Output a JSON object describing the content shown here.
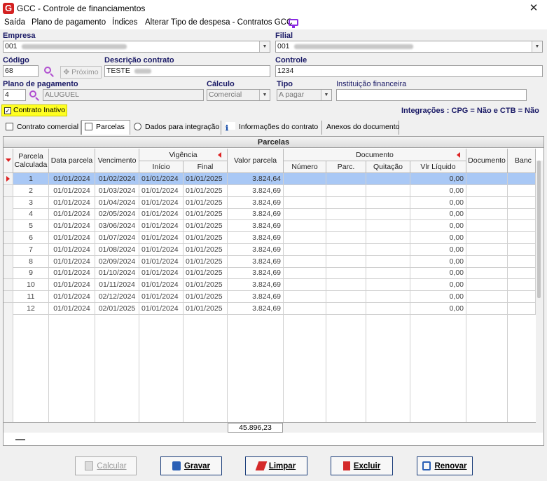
{
  "window": {
    "title": "GCC - Controle de financiamentos",
    "app_icon": "G"
  },
  "menu": [
    "Saída",
    "Plano de pagamento",
    "Índices",
    "Alterar Tipo de despesa - Contratos GCC"
  ],
  "form": {
    "empresa_label": "Empresa",
    "empresa_value": "001",
    "filial_label": "Filial",
    "filial_value": "001",
    "codigo_label": "Código",
    "codigo_value": "68",
    "proximo_label": "Próximo",
    "descricao_label": "Descrição contrato",
    "descricao_value": "TESTE",
    "controle_label": "Controle",
    "controle_value": "1234",
    "plano_label": "Plano de pagamento",
    "plano_code": "4",
    "plano_name": "ALUGUEL",
    "calculo_label": "Cálculo",
    "calculo_value": "Comercial",
    "tipo_label": "Tipo",
    "tipo_value": "A pagar",
    "instituicao_label": "Instituição financeira",
    "instituicao_value": "",
    "inativo_label": "Contrato Inativo",
    "inativo_checked": "✓",
    "integracoes": "Integrações : CPG = Não e CTB = Não"
  },
  "tabs": [
    "Contrato comercial",
    "Parcelas",
    "Dados para integração",
    "Informações do contrato",
    "Anexos do documento"
  ],
  "grid": {
    "title": "Parcelas",
    "headers": {
      "parcela": "Parcela Calculada",
      "data": "Data parcela",
      "vencimento": "Vencimento",
      "vigencia": "Vigência",
      "inicio": "Início",
      "final": "Final",
      "valor": "Valor parcela",
      "documento": "Documento",
      "numero": "Número",
      "parc": "Parc.",
      "quitacao": "Quitação",
      "vlr": "Vlr Líquido",
      "documento2": "Documento",
      "banco": "Banc"
    },
    "rows": [
      {
        "n": "1",
        "data": "01/01/2024",
        "venc": "01/02/2024",
        "ini": "01/01/2024",
        "fim": "01/01/2025",
        "valor": "3.824,64",
        "vlr": "0,00"
      },
      {
        "n": "2",
        "data": "01/01/2024",
        "venc": "01/03/2024",
        "ini": "01/01/2024",
        "fim": "01/01/2025",
        "valor": "3.824,69",
        "vlr": "0,00"
      },
      {
        "n": "3",
        "data": "01/01/2024",
        "venc": "01/04/2024",
        "ini": "01/01/2024",
        "fim": "01/01/2025",
        "valor": "3.824,69",
        "vlr": "0,00"
      },
      {
        "n": "4",
        "data": "01/01/2024",
        "venc": "02/05/2024",
        "ini": "01/01/2024",
        "fim": "01/01/2025",
        "valor": "3.824,69",
        "vlr": "0,00"
      },
      {
        "n": "5",
        "data": "01/01/2024",
        "venc": "03/06/2024",
        "ini": "01/01/2024",
        "fim": "01/01/2025",
        "valor": "3.824,69",
        "vlr": "0,00"
      },
      {
        "n": "6",
        "data": "01/01/2024",
        "venc": "01/07/2024",
        "ini": "01/01/2024",
        "fim": "01/01/2025",
        "valor": "3.824,69",
        "vlr": "0,00"
      },
      {
        "n": "7",
        "data": "01/01/2024",
        "venc": "01/08/2024",
        "ini": "01/01/2024",
        "fim": "01/01/2025",
        "valor": "3.824,69",
        "vlr": "0,00"
      },
      {
        "n": "8",
        "data": "01/01/2024",
        "venc": "02/09/2024",
        "ini": "01/01/2024",
        "fim": "01/01/2025",
        "valor": "3.824,69",
        "vlr": "0,00"
      },
      {
        "n": "9",
        "data": "01/01/2024",
        "venc": "01/10/2024",
        "ini": "01/01/2024",
        "fim": "01/01/2025",
        "valor": "3.824,69",
        "vlr": "0,00"
      },
      {
        "n": "10",
        "data": "01/01/2024",
        "venc": "01/11/2024",
        "ini": "01/01/2024",
        "fim": "01/01/2025",
        "valor": "3.824,69",
        "vlr": "0,00"
      },
      {
        "n": "11",
        "data": "01/01/2024",
        "venc": "02/12/2024",
        "ini": "01/01/2024",
        "fim": "01/01/2025",
        "valor": "3.824,69",
        "vlr": "0,00"
      },
      {
        "n": "12",
        "data": "01/01/2024",
        "venc": "02/01/2025",
        "ini": "01/01/2024",
        "fim": "01/01/2025",
        "valor": "3.824,69",
        "vlr": "0,00"
      }
    ],
    "total": "45.896,23"
  },
  "buttons": {
    "calcular": "Calcular",
    "gravar": "Gravar",
    "limpar": "Limpar",
    "excluir": "Excluir",
    "renovar": "Renovar"
  },
  "colors": {
    "accent": "#1a1a66",
    "selection": "#a9c8f5",
    "inactive_highlight": "#ffff22"
  }
}
